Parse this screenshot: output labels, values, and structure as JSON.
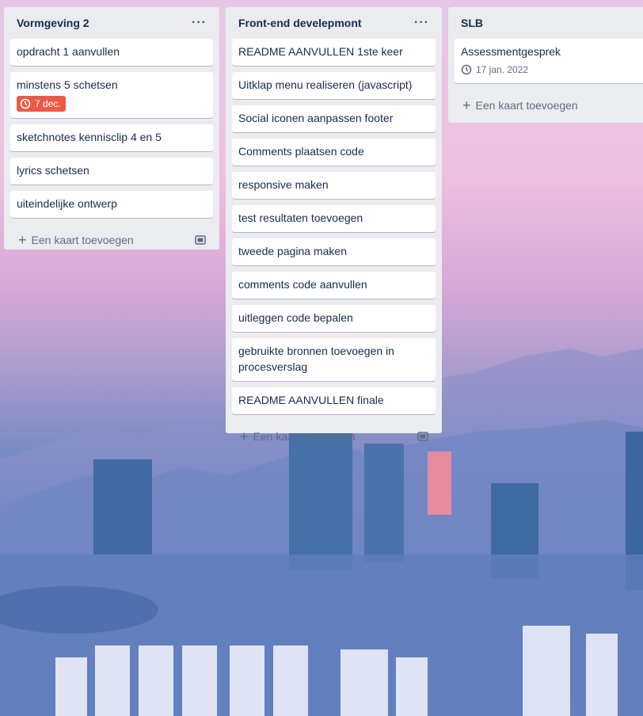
{
  "lists": [
    {
      "title": "Vormgeving 2",
      "menu_icon": "more-icon",
      "cards": [
        {
          "title": "opdracht 1 aanvullen"
        },
        {
          "title": "minstens 5 schetsen",
          "due": "7 dec.",
          "due_status": "overdue"
        },
        {
          "title": "sketchnotes kennisclip 4 en 5"
        },
        {
          "title": "lyrics schetsen"
        },
        {
          "title": "uiteindelijke ontwerp"
        }
      ],
      "add_card_label": "Een kaart toevoegen"
    },
    {
      "title": "Front-end develepmont",
      "menu_icon": "more-icon",
      "cards": [
        {
          "title": "README AANVULLEN 1ste keer"
        },
        {
          "title": "Uitklap menu realiseren (javascript)"
        },
        {
          "title": "Social iconen aanpassen footer"
        },
        {
          "title": "Comments plaatsen code"
        },
        {
          "title": "responsive maken"
        },
        {
          "title": "test resultaten toevoegen"
        },
        {
          "title": "tweede pagina maken"
        },
        {
          "title": "comments code aanvullen"
        },
        {
          "title": "uitleggen code bepalen"
        },
        {
          "title": "gebruikte bronnen toevoegen in procesverslag"
        },
        {
          "title": "README AANVULLEN finale"
        }
      ],
      "add_card_label": "Een kaart toevoegen"
    },
    {
      "title": "SLB",
      "cards": [
        {
          "title": "Assessmentgesprek",
          "due": "17 jan. 2022",
          "due_status": "normal"
        }
      ],
      "add_card_label": "Een kaart toevoegen"
    }
  ],
  "colors": {
    "list_bg": "#ebecf0",
    "overdue": "#eb5a46",
    "text": "#172b4d",
    "muted": "#5e6c84"
  }
}
